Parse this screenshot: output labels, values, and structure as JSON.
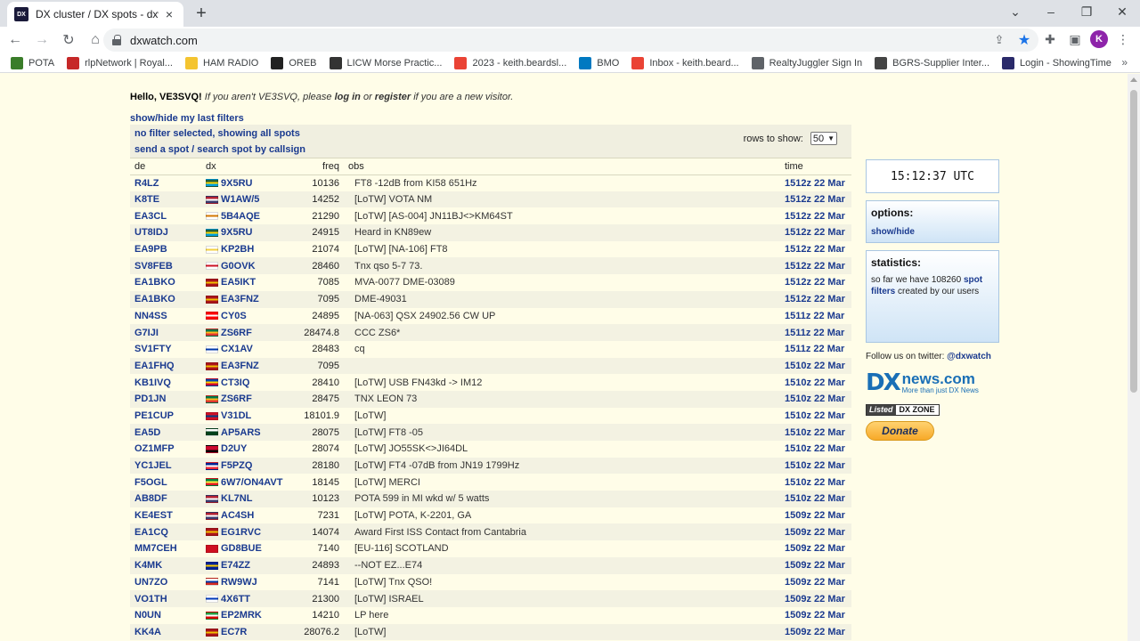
{
  "browser": {
    "tab_title": "DX cluster / DX spots - dxwatch.c",
    "tab_favicon": "DX",
    "url": "dxwatch.com",
    "avatar_letter": "K",
    "bookmarks": [
      {
        "label": "POTA",
        "icon_color": "#3a7d2a"
      },
      {
        "label": "rlpNetwork | Royal...",
        "icon_color": "#c62828"
      },
      {
        "label": "HAM RADIO",
        "icon_color": "#f4c430"
      },
      {
        "label": "OREB",
        "icon_color": "#222222"
      },
      {
        "label": "LICW Morse Practic...",
        "icon_color": "#333333"
      },
      {
        "label": "2023 - keith.beardsl...",
        "icon_color": "#ea4335"
      },
      {
        "label": "BMO",
        "icon_color": "#0079c1"
      },
      {
        "label": "Inbox - keith.beard...",
        "icon_color": "#ea4335"
      },
      {
        "label": "RealtyJuggler Sign In",
        "icon_color": "#5f6368"
      },
      {
        "label": "BGRS-Supplier Inter...",
        "icon_color": "#444444"
      },
      {
        "label": "Login - ShowingTime",
        "icon_color": "#2a2a6a"
      }
    ]
  },
  "greeting": {
    "hello": "Hello, VE3SVQ!",
    "pre": " If you aren't VE3SVQ, please ",
    "login": "log in",
    "or": " or ",
    "register": "register",
    "post": " if you are a new visitor."
  },
  "last_filters_link": "show/hide my last filters",
  "spots_header": {
    "filter_text": "no filter selected, showing all spots",
    "send_spot": "send a spot / search spot by callsign",
    "rows_label": "rows to show:",
    "rows_value": "50"
  },
  "columns": {
    "de": "de",
    "dx": "dx",
    "freq": "freq",
    "obs": "obs",
    "time": "time"
  },
  "spots": [
    {
      "de": "R4LZ",
      "dx": "9X5RU",
      "flag": "rw",
      "freq": "10136",
      "obs": "FT8 -12dB from KI58 651Hz",
      "time": "1512z 22 Mar"
    },
    {
      "de": "K8TE",
      "dx": "W1AW/5",
      "flag": "us",
      "freq": "14252",
      "obs": "[LoTW] VOTA NM",
      "time": "1512z 22 Mar"
    },
    {
      "de": "EA3CL",
      "dx": "5B4AQE",
      "flag": "cy",
      "freq": "21290",
      "obs": "[LoTW] [AS-004] JN11BJ<>KM64ST",
      "time": "1512z 22 Mar"
    },
    {
      "de": "UT8IDJ",
      "dx": "9X5RU",
      "flag": "rw",
      "freq": "24915",
      "obs": "Heard in KN89ew",
      "time": "1512z 22 Mar"
    },
    {
      "de": "EA9PB",
      "dx": "KP2BH",
      "flag": "vi",
      "freq": "21074",
      "obs": "[LoTW] [NA-106] FT8",
      "time": "1512z 22 Mar"
    },
    {
      "de": "SV8FEB",
      "dx": "G0OVK",
      "flag": "en",
      "freq": "28460",
      "obs": "Tnx qso 5-7 73.",
      "time": "1512z 22 Mar"
    },
    {
      "de": "EA1BKO",
      "dx": "EA5IKT",
      "flag": "es",
      "freq": "7085",
      "obs": "MVA-0077 DME-03089",
      "time": "1512z 22 Mar"
    },
    {
      "de": "EA1BKO",
      "dx": "EA3FNZ",
      "flag": "es",
      "freq": "7095",
      "obs": "DME-49031",
      "time": "1512z 22 Mar"
    },
    {
      "de": "NN4SS",
      "dx": "CY0S",
      "flag": "ca",
      "freq": "24895",
      "obs": "[NA-063] QSX 24902.56 CW UP",
      "time": "1511z 22 Mar"
    },
    {
      "de": "G7IJI",
      "dx": "ZS6RF",
      "flag": "za",
      "freq": "28474.8",
      "obs": "CCC ZS6*",
      "time": "1511z 22 Mar"
    },
    {
      "de": "SV1FTY",
      "dx": "CX1AV",
      "flag": "uy",
      "freq": "28483",
      "obs": "cq",
      "time": "1511z 22 Mar"
    },
    {
      "de": "EA1FHQ",
      "dx": "EA3FNZ",
      "flag": "es",
      "freq": "7095",
      "obs": "",
      "time": "1510z 22 Mar"
    },
    {
      "de": "KB1IVQ",
      "dx": "CT3IQ",
      "flag": "md",
      "freq": "28410",
      "obs": "[LoTW] USB FN43kd -> IM12",
      "time": "1510z 22 Mar"
    },
    {
      "de": "PD1JN",
      "dx": "ZS6RF",
      "flag": "za",
      "freq": "28475",
      "obs": "TNX LEON 73",
      "time": "1510z 22 Mar"
    },
    {
      "de": "PE1CUP",
      "dx": "V31DL",
      "flag": "bz",
      "freq": "18101.9",
      "obs": "[LoTW]",
      "time": "1510z 22 Mar"
    },
    {
      "de": "EA5D",
      "dx": "AP5ARS",
      "flag": "pk",
      "freq": "28075",
      "obs": "[LoTW] FT8 -05",
      "time": "1510z 22 Mar"
    },
    {
      "de": "OZ1MFP",
      "dx": "D2UY",
      "flag": "ao",
      "freq": "28074",
      "obs": "[LoTW] JO55SK<>JI64DL",
      "time": "1510z 22 Mar"
    },
    {
      "de": "YC1JEL",
      "dx": "F5PZQ",
      "flag": "fr",
      "freq": "28180",
      "obs": "[LoTW] FT4 -07dB from JN19 1799Hz",
      "time": "1510z 22 Mar"
    },
    {
      "de": "F5OGL",
      "dx": "6W7/ON4AVT",
      "flag": "sn",
      "freq": "18145",
      "obs": "[LoTW] MERCI",
      "time": "1510z 22 Mar"
    },
    {
      "de": "AB8DF",
      "dx": "KL7NL",
      "flag": "us",
      "freq": "10123",
      "obs": "POTA 599 in MI wkd w/ 5 watts",
      "time": "1510z 22 Mar"
    },
    {
      "de": "KE4EST",
      "dx": "AC4SH",
      "flag": "us",
      "freq": "7231",
      "obs": "[LoTW] POTA, K-2201, GA",
      "time": "1509z 22 Mar"
    },
    {
      "de": "EA1CQ",
      "dx": "EG1RVC",
      "flag": "es",
      "freq": "14074",
      "obs": "Award First ISS Contact from Cantabria",
      "time": "1509z 22 Mar"
    },
    {
      "de": "MM7CEH",
      "dx": "GD8BUE",
      "flag": "im",
      "freq": "7140",
      "obs": "[EU-116] SCOTLAND",
      "time": "1509z 22 Mar"
    },
    {
      "de": "K4MK",
      "dx": "E74ZZ",
      "flag": "ba",
      "freq": "24893",
      "obs": "--NOT EZ...E74",
      "time": "1509z 22 Mar"
    },
    {
      "de": "UN7ZO",
      "dx": "RW9WJ",
      "flag": "ru",
      "freq": "7141",
      "obs": "[LoTW] Tnx QSO!",
      "time": "1509z 22 Mar"
    },
    {
      "de": "VO1TH",
      "dx": "4X6TT",
      "flag": "il",
      "freq": "21300",
      "obs": "[LoTW] ISRAEL",
      "time": "1509z 22 Mar"
    },
    {
      "de": "N0UN",
      "dx": "EP2MRK",
      "flag": "ir",
      "freq": "14210",
      "obs": "LP here",
      "time": "1509z 22 Mar"
    },
    {
      "de": "KK4A",
      "dx": "EC7R",
      "flag": "es",
      "freq": "28076.2",
      "obs": "[LoTW]",
      "time": "1509z 22 Mar"
    }
  ],
  "sidebar": {
    "clock": "15:12:37 UTC",
    "options_title": "options:",
    "options_link": "show/hide",
    "stats_title": "statistics:",
    "stats_pre": "so far we have 108260 ",
    "stats_link": "spot filters",
    "stats_post": " created by our users",
    "follow_pre": "Follow us on twitter: ",
    "follow_link": "@dxwatch",
    "dxnews_big": "news.com",
    "dxnews_small": "More than just DX News",
    "dxzone_left": "Listed",
    "dxzone_right": "DX ZONE",
    "donate": "Donate"
  },
  "flag_colors": {
    "rw": [
      "#20603d",
      "#fad201",
      "#00a1de"
    ],
    "us": [
      "#b22234",
      "#ffffff",
      "#3c3b6e"
    ],
    "cy": [
      "#ffffff",
      "#d57800",
      "#ffffff"
    ],
    "vi": [
      "#ffffff",
      "#f4d03f",
      "#ffffff"
    ],
    "en": [
      "#ffffff",
      "#ce1124",
      "#ffffff"
    ],
    "es": [
      "#aa151b",
      "#f1bf00",
      "#aa151b"
    ],
    "ca": [
      "#ff0000",
      "#ffffff",
      "#ff0000"
    ],
    "za": [
      "#007749",
      "#ffb81c",
      "#de3831"
    ],
    "uy": [
      "#ffffff",
      "#0038a8",
      "#ffffff"
    ],
    "md": [
      "#0046ae",
      "#ffd200",
      "#cc092f"
    ],
    "bz": [
      "#ce1126",
      "#003f87",
      "#ce1126"
    ],
    "pk": [
      "#ffffff",
      "#01411c",
      "#01411c"
    ],
    "ao": [
      "#cc092f",
      "#cc092f",
      "#000000"
    ],
    "fr": [
      "#002395",
      "#ffffff",
      "#ed2939"
    ],
    "sn": [
      "#00853f",
      "#fdef42",
      "#e31b23"
    ],
    "im": [
      "#cf1020",
      "#cf1020",
      "#cf1020"
    ],
    "ba": [
      "#002395",
      "#fecb00",
      "#002395"
    ],
    "ru": [
      "#ffffff",
      "#0039a6",
      "#d52b1e"
    ],
    "il": [
      "#ffffff",
      "#0038b8",
      "#ffffff"
    ],
    "ir": [
      "#239f40",
      "#ffffff",
      "#da0000"
    ]
  }
}
